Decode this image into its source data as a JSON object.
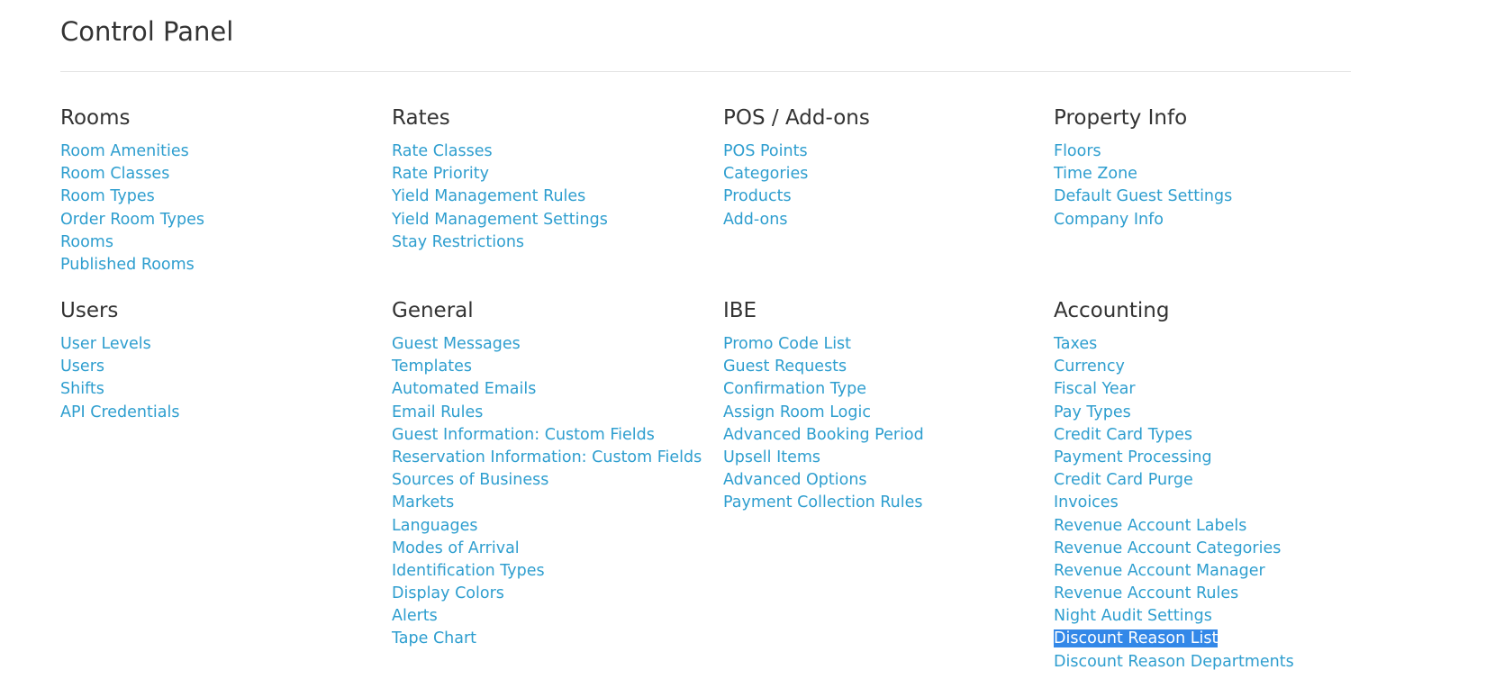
{
  "page": {
    "title": "Control Panel"
  },
  "sections": {
    "rooms": {
      "title": "Rooms",
      "links": [
        "Room Amenities",
        "Room Classes",
        "Room Types",
        "Order Room Types",
        "Rooms",
        "Published Rooms"
      ]
    },
    "rates": {
      "title": "Rates",
      "links": [
        "Rate Classes",
        "Rate Priority",
        "Yield Management Rules",
        "Yield Management Settings",
        "Stay Restrictions"
      ]
    },
    "pos": {
      "title": "POS / Add-ons",
      "links": [
        "POS Points",
        "Categories",
        "Products",
        "Add-ons"
      ]
    },
    "property": {
      "title": "Property Info",
      "links": [
        "Floors",
        "Time Zone",
        "Default Guest Settings",
        "Company Info"
      ]
    },
    "users": {
      "title": "Users",
      "links": [
        "User Levels",
        "Users",
        "Shifts",
        "API Credentials"
      ]
    },
    "general": {
      "title": "General",
      "links": [
        "Guest Messages",
        "Templates",
        "Automated Emails",
        "Email Rules",
        "Guest Information: Custom Fields",
        "Reservation Information: Custom Fields",
        "Sources of Business",
        "Markets",
        "Languages",
        "Modes of Arrival",
        "Identification Types",
        "Display Colors",
        "Alerts",
        "Tape Chart"
      ]
    },
    "ibe": {
      "title": "IBE",
      "links": [
        "Promo Code List",
        "Guest Requests",
        "Confirmation Type",
        "Assign Room Logic",
        "Advanced Booking Period",
        "Upsell Items",
        "Advanced Options",
        "Payment Collection Rules"
      ]
    },
    "accounting": {
      "title": "Accounting",
      "links": [
        "Taxes",
        "Currency",
        "Fiscal Year",
        "Pay Types",
        "Credit Card Types",
        "Payment Processing",
        "Credit Card Purge",
        "Invoices",
        "Revenue Account Labels",
        "Revenue Account Categories",
        "Revenue Account Manager",
        "Revenue Account Rules",
        "Night Audit Settings",
        "Discount Reason List",
        "Discount Reason Departments"
      ],
      "selected_index": 13
    }
  },
  "colors": {
    "link": "#2e9ecf",
    "selection": "#3388e8",
    "heading": "#333333"
  }
}
